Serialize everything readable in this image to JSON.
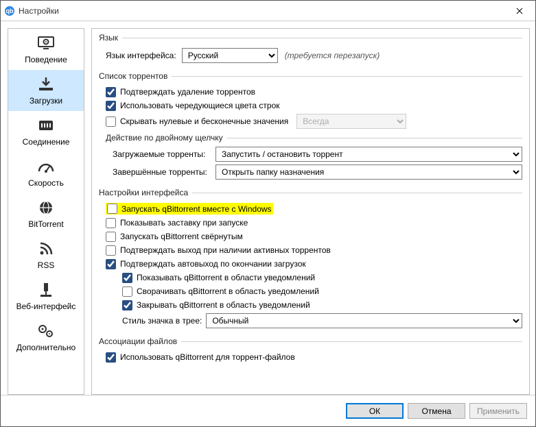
{
  "window": {
    "title": "Настройки"
  },
  "sidebar": {
    "items": [
      {
        "key": "behavior",
        "label": "Поведение"
      },
      {
        "key": "downloads",
        "label": "Загрузки"
      },
      {
        "key": "connection",
        "label": "Соединение"
      },
      {
        "key": "speed",
        "label": "Скорость"
      },
      {
        "key": "bittorrent",
        "label": "BitTorrent"
      },
      {
        "key": "rss",
        "label": "RSS"
      },
      {
        "key": "webui",
        "label": "Веб-интерфейс"
      },
      {
        "key": "advanced",
        "label": "Дополнительно"
      }
    ],
    "selected": "downloads"
  },
  "groups": {
    "language": {
      "title": "Язык",
      "label": "Язык интерфейса:",
      "value": "Русский",
      "hint": "(требуется перезапуск)"
    },
    "torrentList": {
      "title": "Список торрентов",
      "confirmDelete": {
        "label": "Подтверждать удаление торрентов",
        "checked": true
      },
      "alternatingRows": {
        "label": "Использовать чередующиеся цвета строк",
        "checked": true
      },
      "hideZero": {
        "label": "Скрывать нулевые и бесконечные значения",
        "checked": false
      },
      "hideZeroMode": {
        "value": "Всегда"
      },
      "doubleClick": {
        "title": "Действие по двойному щелчку",
        "downloading": {
          "label": "Загружаемые торренты:",
          "value": "Запустить / остановить торрент"
        },
        "completed": {
          "label": "Завершённые торренты:",
          "value": "Открыть папку назначения"
        }
      }
    },
    "interface": {
      "title": "Настройки интерфейса",
      "startWithWindows": {
        "label": "Запускать qBittorrent вместе с Windows",
        "checked": false
      },
      "showSplash": {
        "label": "Показывать заставку при запуске",
        "checked": false
      },
      "startMinimized": {
        "label": "Запускать qBittorrent свёрнутым",
        "checked": false
      },
      "confirmExitActive": {
        "label": "Подтверждать выход при наличии активных торрентов",
        "checked": false
      },
      "confirmAutoExit": {
        "label": "Подтверждать автовыход по окончании загрузок",
        "checked": true
      },
      "showTray": {
        "label": "Показывать qBittorrent в области уведомлений",
        "checked": true
      },
      "minimizeToTray": {
        "label": "Сворачивать qBittorrent в область уведомлений",
        "checked": false
      },
      "closeToTray": {
        "label": "Закрывать qBittorrent в область уведомлений",
        "checked": true
      },
      "trayStyle": {
        "label": "Стиль значка в трее:",
        "value": "Обычный"
      }
    },
    "fileAssoc": {
      "title": "Ассоциации файлов",
      "torrentFiles": {
        "label": "Использовать qBittorrent для торрент-файлов",
        "checked": true
      }
    }
  },
  "footer": {
    "ok": "ОК",
    "cancel": "Отмена",
    "apply": "Применить"
  }
}
